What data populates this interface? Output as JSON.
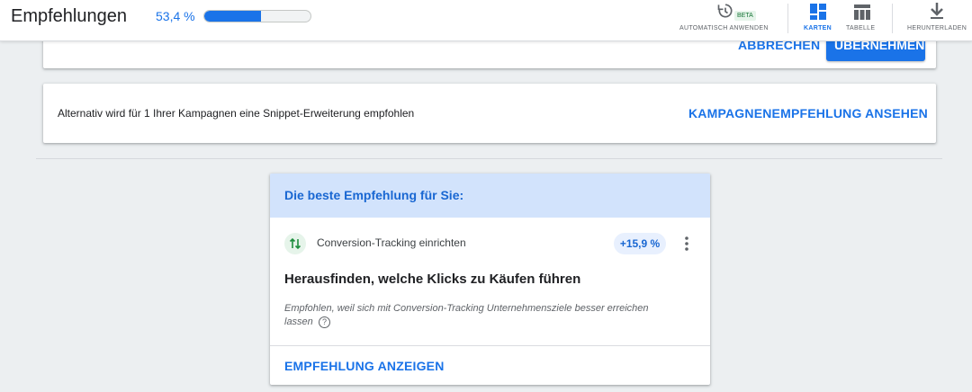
{
  "header": {
    "title": "Empfehlungen",
    "optimization_score": "53,4 %",
    "optimization_progress": 0.534,
    "tools": {
      "auto_apply": "AUTOMATISCH ANWENDEN",
      "beta_badge": "BETA",
      "cards": "KARTEN",
      "table": "TABELLE",
      "download": "HERUNTERLADEN"
    }
  },
  "top_card": {
    "cancel": "ABBRECHEN",
    "apply": "ÜBERNEHMEN"
  },
  "alt_card": {
    "text": "Alternativ wird für 1 Ihrer Kampagnen eine Snippet-Erweiterung empfohlen",
    "link": "KAMPAGNENEMPFEHLUNG ANSEHEN"
  },
  "best_card": {
    "heading": "Die beste Empfehlung für Sie:",
    "category": "Conversion-Tracking einrichten",
    "uplift": "+15,9 %",
    "title": "Herausfinden, welche Klicks zu Käufen führen",
    "reason_line1": "Empfohlen, weil sich mit Conversion-Tracking Unternehmensziele besser erreichen",
    "reason_line2": "lassen",
    "action": "EMPFEHLUNG ANZEIGEN"
  },
  "colors": {
    "accent": "#1a73e8",
    "header_band": "#d2e3fc",
    "beta_bg": "#e6f4ea",
    "tracking_icon": "#1e8e3e"
  },
  "icons": [
    "auto-apply-icon",
    "cards-view-icon",
    "table-view-icon",
    "download-icon",
    "conversion-tracking-icon",
    "more-vert-icon",
    "help-icon"
  ]
}
